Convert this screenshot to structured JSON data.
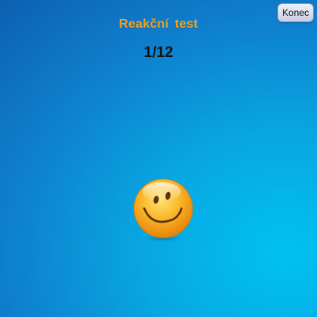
{
  "game": {
    "title": "Reakční  test",
    "counter": "1/12",
    "end_button_label": "Konec",
    "target_icon": "smiley-face-icon"
  },
  "colors": {
    "title": "#f7a21a",
    "background_top": "#0d60b2",
    "background_bottom": "#00c2f2",
    "smiley_face": "#f5a30e"
  }
}
